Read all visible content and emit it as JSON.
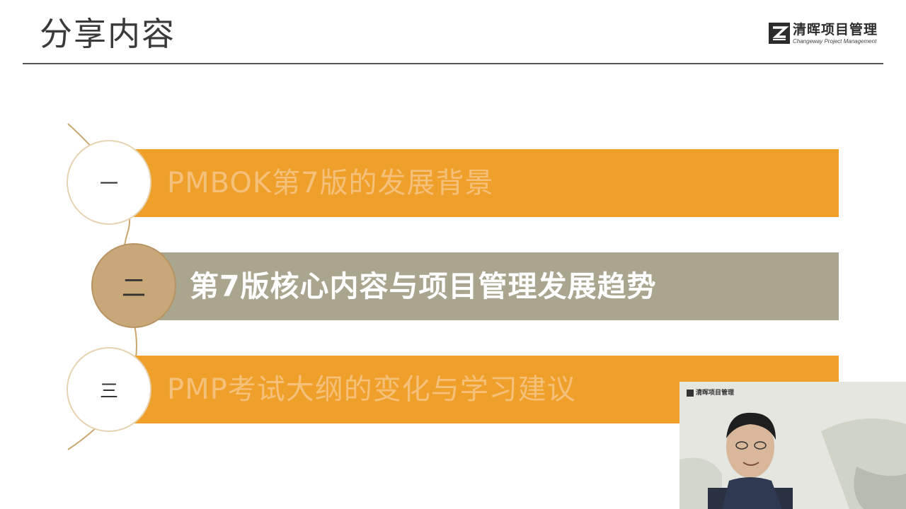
{
  "header": {
    "title": "分享内容",
    "logo_name": "清晖项目管理",
    "logo_sub": "Changeway Project Management"
  },
  "agenda": {
    "items": [
      {
        "number": "一",
        "label": "PMBOK第7版的发展背景",
        "state": "inactive"
      },
      {
        "number": "二",
        "label": "第7版核心内容与项目管理发展趋势",
        "state": "active"
      },
      {
        "number": "三",
        "label": "PMP考试大纲的变化与学习建议",
        "state": "inactive"
      }
    ]
  },
  "video_overlay": {
    "logo_name": "清晖项目管理"
  },
  "colors": {
    "accent_orange": "#efa02b",
    "active_bar": "#aaa58f",
    "active_circle": "#c8a878",
    "inactive_text": "#f4c07a"
  }
}
